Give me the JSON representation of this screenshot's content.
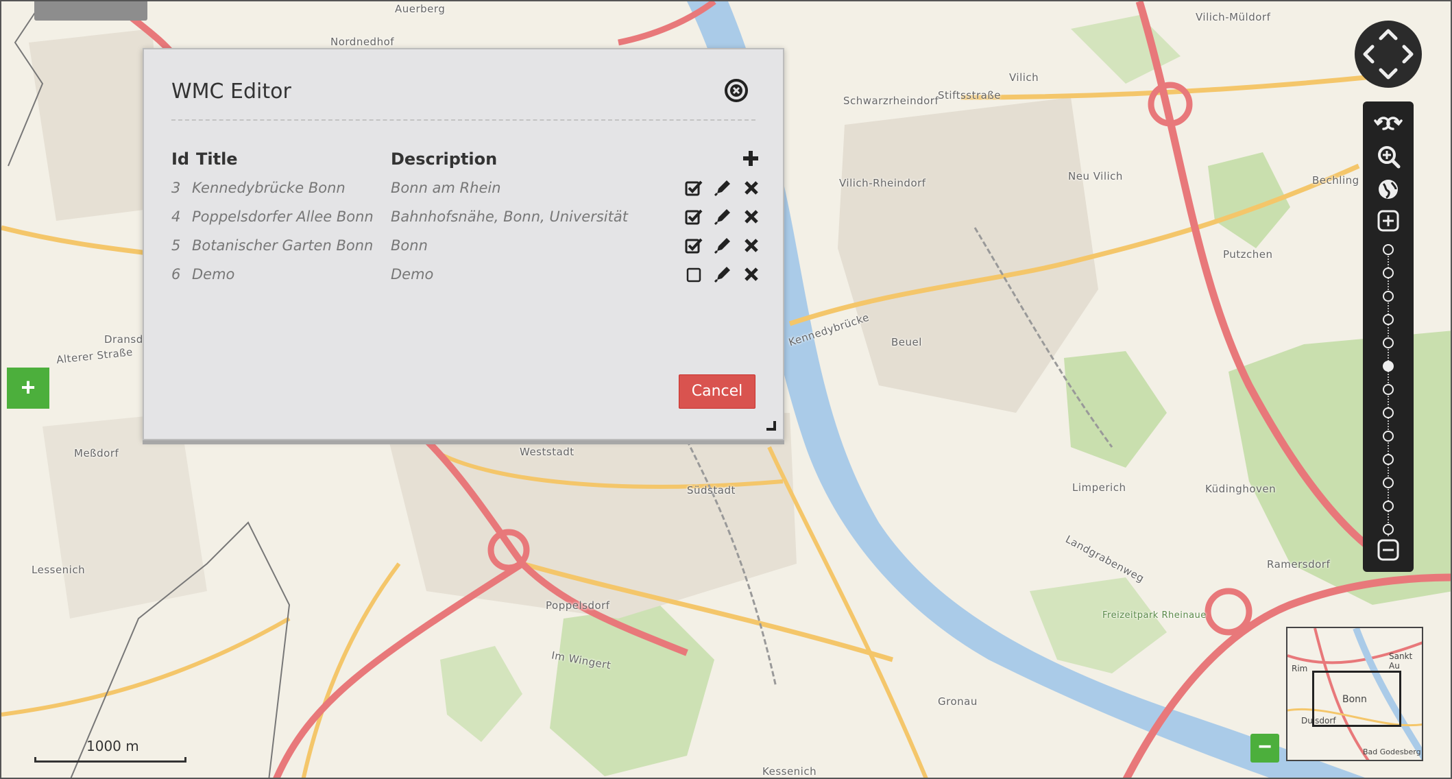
{
  "dialog": {
    "title": "WMC Editor",
    "headers": {
      "id": "Id",
      "title": "Title",
      "description": "Description"
    },
    "rows": [
      {
        "id": "3",
        "title": "Kennedybrücke Bonn",
        "description": "Bonn am Rhein",
        "checked": true
      },
      {
        "id": "4",
        "title": "Poppelsdorfer Allee Bonn",
        "description": "Bahnhofsnähe, Bonn, Universität",
        "checked": true
      },
      {
        "id": "5",
        "title": "Botanischer Garten Bonn",
        "description": "Bonn",
        "checked": true
      },
      {
        "id": "6",
        "title": "Demo",
        "description": "Demo",
        "checked": false
      }
    ],
    "cancel_label": "Cancel"
  },
  "map": {
    "labels": {
      "auerberg": "Auerberg",
      "nordliche": "Nordnedhof",
      "vilich_muldorf": "Vilich-Müldorf",
      "vilich": "Vilich",
      "schwarzrheindorf": "Schwarzrheindorf",
      "stiftsstrasse": "Stiftsstraße",
      "neu_vilich": "Neu Vilich",
      "vilich_rheindorf": "Vilich-Rheindorf",
      "beuel": "Beuel",
      "kennedybrucke": "Kennedybrücke",
      "putzchen": "Putzchen",
      "bechling": "Bechling",
      "dransdorf": "Dransd",
      "alterer_strasse": "Alterer Straße",
      "messdorf": "Meßdorf",
      "lessenich": "Lessenich",
      "weststadt": "Weststadt",
      "sudstadt": "Südstadt",
      "poppelsdorf": "Poppelsdorf",
      "im_wingert": "Im Wingert",
      "limperich": "Limperich",
      "kudinghoven": "Küdinghoven",
      "ramersdorf": "Ramersdorf",
      "gronau": "Gronau",
      "kessenich": "Kessenich",
      "landgrabenweg": "Landgrabenweg",
      "rheinaue": "Freizeitpark Rheinaue"
    },
    "scale_label": "1000 m",
    "overview": {
      "bonn": "Bonn",
      "sankt_au": "Sankt Au",
      "bad_godesberg": "Bad Godesberg",
      "duisdorf": "Duisdorf",
      "rim": "Rim"
    }
  },
  "colors": {
    "cancel": "#d9534f",
    "layer_button": "#4caf3c",
    "toolbar": "#222222",
    "road_major": "#e8787a",
    "road_yellow": "#f4c66a",
    "water": "#aacbe8",
    "forest": "#c9dfae"
  },
  "icons": {
    "close": "close-circle-icon",
    "add": "plus-icon",
    "checked": "checkbox-checked-icon",
    "unchecked": "checkbox-empty-icon",
    "edit": "pencil-icon",
    "delete": "x-icon"
  }
}
